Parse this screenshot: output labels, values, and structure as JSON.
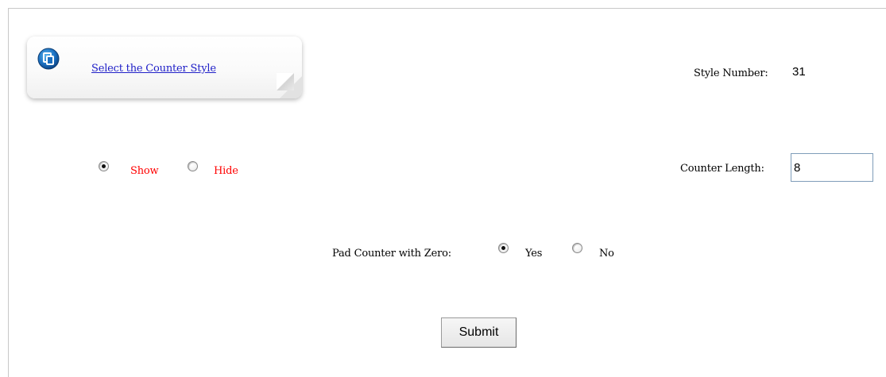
{
  "style_section": {
    "link_text": "Select the Counter Style",
    "icon": "copy-document-icon",
    "style_number_label": "Style Number:",
    "style_number_value": "31"
  },
  "visibility": {
    "options": [
      {
        "label": "Show",
        "selected": true
      },
      {
        "label": "Hide",
        "selected": false
      }
    ],
    "label_color": "#ff0000"
  },
  "counter_length": {
    "label": "Counter Length:",
    "value": "8"
  },
  "pad_zero": {
    "label": "Pad Counter with Zero:",
    "options": [
      {
        "label": "Yes",
        "selected": true
      },
      {
        "label": "No",
        "selected": false
      }
    ]
  },
  "submit_label": "Submit"
}
